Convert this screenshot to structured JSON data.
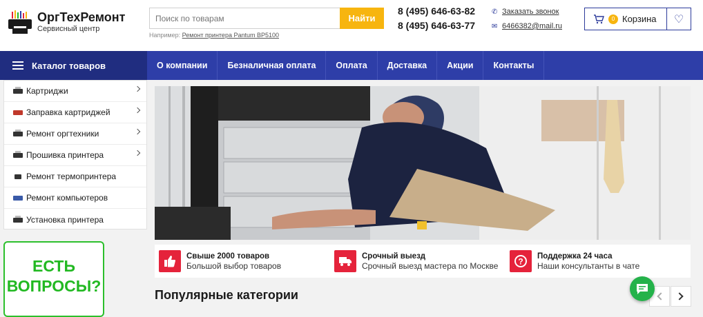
{
  "header": {
    "logo": {
      "title": "ОргТехРемонт",
      "subtitle": "Сервисный центр"
    },
    "search": {
      "placeholder": "Поиск по товарам",
      "button_label": "Найти",
      "example_prefix": "Например:",
      "example_link": "Ремонт принтера Pantum BP5100"
    },
    "phones": [
      "8 (495) 646-63-82",
      "8 (495) 646-63-77"
    ],
    "callback_label": "Заказать звонок",
    "email": "6466382@mail.ru",
    "cart": {
      "count": "0",
      "label": "Корзина"
    }
  },
  "nav": {
    "catalog_label": "Каталог товаров",
    "items": [
      "О компании",
      "Безналичная оплата",
      "Оплата",
      "Доставка",
      "Акции",
      "Контакты"
    ]
  },
  "sidebar": {
    "items": [
      {
        "label": "Картриджи",
        "has_submenu": true
      },
      {
        "label": "Заправка картриджей",
        "has_submenu": true
      },
      {
        "label": "Ремонт оргтехники",
        "has_submenu": true
      },
      {
        "label": "Прошивка принтера",
        "has_submenu": true
      },
      {
        "label": "Ремонт термопринтера",
        "has_submenu": false
      },
      {
        "label": "Ремонт компьютеров",
        "has_submenu": false
      },
      {
        "label": "Установка принтера",
        "has_submenu": false
      }
    ]
  },
  "questions": {
    "line1": "ЕСТЬ",
    "line2": "ВОПРОСЫ?"
  },
  "features": [
    {
      "icon": "thumbs-up-icon",
      "title": "Свыше 2000 товаров",
      "subtitle": "Большой выбор товаров"
    },
    {
      "icon": "truck-icon",
      "title": "Срочный выезд",
      "subtitle": "Срочный выезд мастера по Москве"
    },
    {
      "icon": "help-icon",
      "title": "Поддержка 24 часа",
      "subtitle": "Наши консультанты в чате"
    }
  ],
  "popular_title": "Популярные категории",
  "colors": {
    "nav": "#2e3ea8",
    "nav_dark": "#202d80",
    "accent": "#f7b50f",
    "feature": "#e5233b",
    "green": "#22b922"
  }
}
